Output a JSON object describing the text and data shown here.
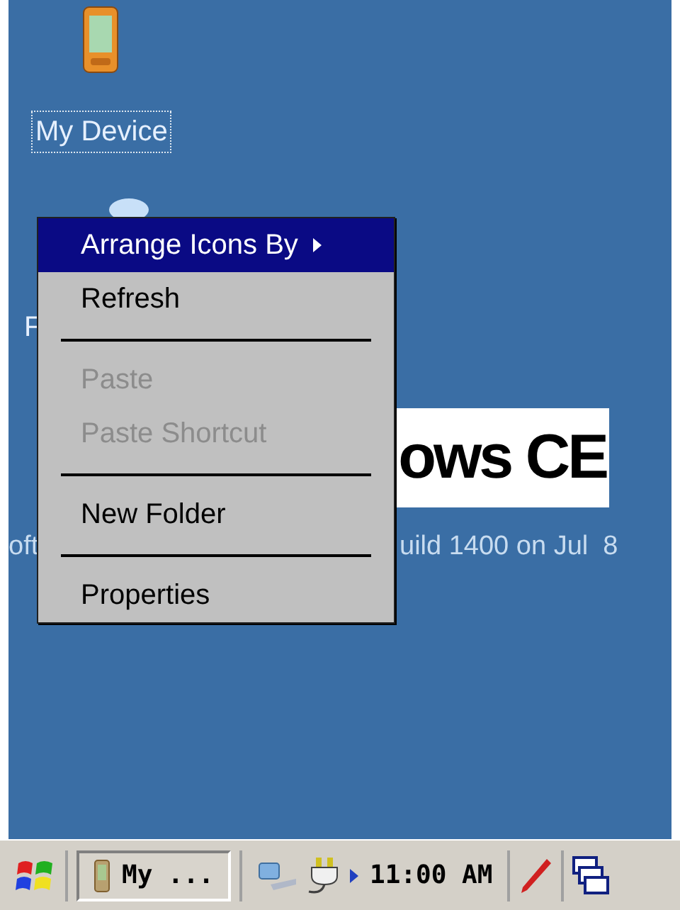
{
  "desktop": {
    "icons": [
      {
        "label": "My Device",
        "selected": true
      },
      {
        "label": "F",
        "selected": false
      }
    ],
    "logo": {
      "text": "ows CE"
    },
    "build_text": [
      "oft",
      "uild 1400 on Jul  8"
    ]
  },
  "context_menu": [
    {
      "kind": "item",
      "label": "Arrange Icons By",
      "selected": true,
      "disabled": false,
      "submenu": true
    },
    {
      "kind": "item",
      "label": "Refresh",
      "selected": false,
      "disabled": false,
      "submenu": false
    },
    {
      "kind": "separator"
    },
    {
      "kind": "item",
      "label": "Paste",
      "selected": false,
      "disabled": true,
      "submenu": false
    },
    {
      "kind": "item",
      "label": "Paste Shortcut",
      "selected": false,
      "disabled": true,
      "submenu": false
    },
    {
      "kind": "separator"
    },
    {
      "kind": "item",
      "label": "New Folder",
      "selected": false,
      "disabled": false,
      "submenu": false
    },
    {
      "kind": "separator"
    },
    {
      "kind": "item",
      "label": "Properties",
      "selected": false,
      "disabled": false,
      "submenu": false
    }
  ],
  "taskbar": {
    "task_button": "My ...",
    "clock": "11:00 AM"
  }
}
